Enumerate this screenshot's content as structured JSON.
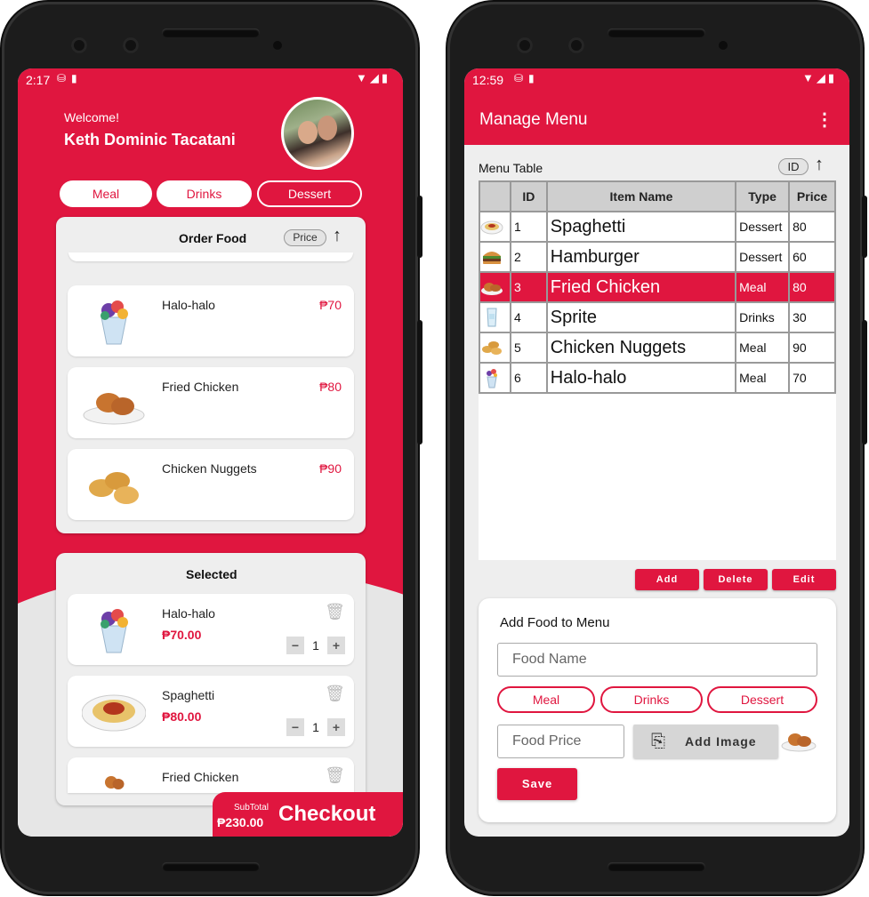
{
  "left_phone": {
    "status": {
      "time": "2:17"
    },
    "header": {
      "welcome": "Welcome!",
      "user_name": "Keth Dominic Tacatani"
    },
    "categories": [
      {
        "label": "Meal",
        "active": false
      },
      {
        "label": "Drinks",
        "active": false
      },
      {
        "label": "Dessert",
        "active": true
      }
    ],
    "order_food": {
      "title": "Order Food",
      "sort_chip": "Price",
      "items": [
        {
          "name": "Halo-halo",
          "price": "₱70",
          "icon": "halo-halo"
        },
        {
          "name": "Fried Chicken",
          "price": "₱80",
          "icon": "fried-chicken"
        },
        {
          "name": "Chicken Nuggets",
          "price": "₱90",
          "icon": "chicken-nuggets"
        }
      ]
    },
    "selected": {
      "title": "Selected",
      "items": [
        {
          "name": "Halo-halo",
          "price": "₱70.00",
          "qty": "1",
          "icon": "halo-halo"
        },
        {
          "name": "Spaghetti",
          "price": "₱80.00",
          "qty": "1",
          "icon": "spaghetti"
        },
        {
          "name": "Fried Chicken",
          "icon": "fried-chicken"
        }
      ]
    },
    "checkout": {
      "subtotal_label": "SubTotal",
      "subtotal": "₱230.00",
      "label": "Checkout"
    }
  },
  "right_phone": {
    "status": {
      "time": "12:59"
    },
    "app_title": "Manage Menu",
    "table_label": "Menu Table",
    "sort_chip": "ID",
    "columns": [
      "",
      "ID",
      "Item Name",
      "Type",
      "Price"
    ],
    "rows": [
      {
        "id": "1",
        "name": "Spaghetti",
        "type": "Dessert",
        "price": "80",
        "icon": "spaghetti",
        "selected": false
      },
      {
        "id": "2",
        "name": "Hamburger",
        "type": "Dessert",
        "price": "60",
        "icon": "hamburger",
        "selected": false
      },
      {
        "id": "3",
        "name": "Fried Chicken",
        "type": "Meal",
        "price": "80",
        "icon": "fried-chicken",
        "selected": true
      },
      {
        "id": "4",
        "name": "Sprite",
        "type": "Drinks",
        "price": "30",
        "icon": "sprite",
        "selected": false
      },
      {
        "id": "5",
        "name": "Chicken Nuggets",
        "type": "Meal",
        "price": "90",
        "icon": "chicken-nuggets",
        "selected": false
      },
      {
        "id": "6",
        "name": "Halo-halo",
        "type": "Meal",
        "price": "70",
        "icon": "halo-halo",
        "selected": false
      }
    ],
    "actions": {
      "add": "Add",
      "delete": "Delete",
      "edit": "Edit"
    },
    "form": {
      "title": "Add Food to Menu",
      "food_name_placeholder": "Food Name",
      "categories": [
        "Meal",
        "Drinks",
        "Dessert"
      ],
      "food_price_placeholder": "Food Price",
      "add_image": "Add Image",
      "save": "Save"
    }
  },
  "colors": {
    "accent": "#e0163f",
    "surface": "#eeeeee",
    "chip": "#e4e4e4"
  }
}
